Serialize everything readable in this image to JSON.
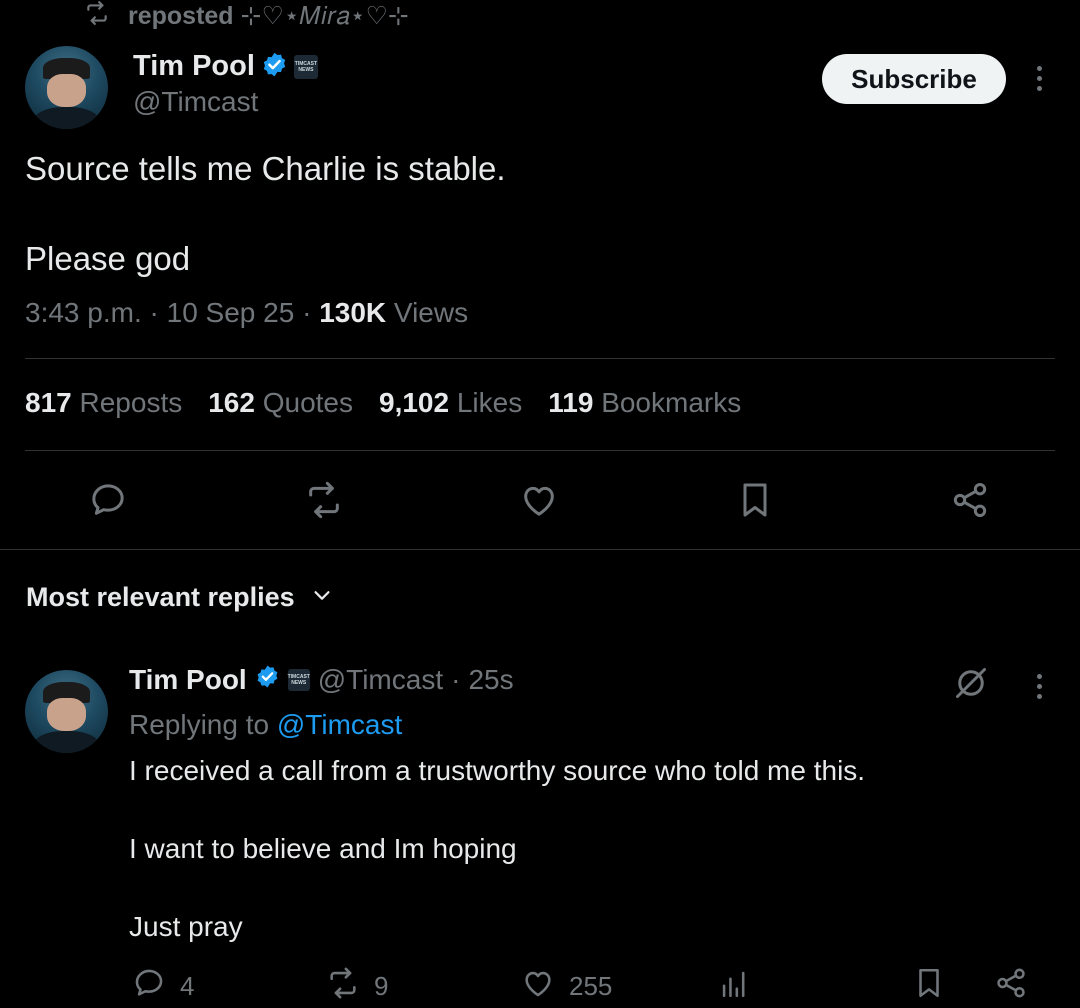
{
  "repost": {
    "text": "reposted",
    "by": "⊹♡⋆𝑀𝑖𝑟𝑎⋆♡⊹",
    "icon": "repost-icon"
  },
  "tweet": {
    "author_name": "Tim Pool",
    "handle": "@Timcast",
    "org_badge_text": "TIMCAST NEWS",
    "subscribe_label": "Subscribe",
    "text_line1": "Source tells me Charlie is stable.",
    "text_line2": "Please god",
    "time": "3:43 p.m.",
    "date": "10 Sep 25",
    "views_count": "130K",
    "views_label": "Views",
    "separator": "·"
  },
  "stats": [
    {
      "count": "817",
      "label": "Reposts"
    },
    {
      "count": "162",
      "label": "Quotes"
    },
    {
      "count": "9,102",
      "label": "Likes"
    },
    {
      "count": "119",
      "label": "Bookmarks"
    }
  ],
  "actions": [
    "reply-icon",
    "repost-icon",
    "like-icon",
    "bookmark-icon",
    "share-icon"
  ],
  "replies_header": {
    "label": "Most relevant replies"
  },
  "reply": {
    "author_name": "Tim Pool",
    "handle": "@Timcast",
    "time": "25s",
    "separator": "·",
    "replying_to_label": "Replying to",
    "replying_to_handle": "@Timcast",
    "line1": "I received a call from a trustworthy source who told me this.",
    "line2": "I want to believe and Im hoping",
    "line3": "Just pray",
    "replies_count": "4",
    "reposts_count": "9",
    "likes_count": "255"
  },
  "colors": {
    "background": "#000000",
    "text": "#e7e9ea",
    "muted": "#71767b",
    "accent": "#1d9bf0",
    "divider": "#2f3336"
  }
}
